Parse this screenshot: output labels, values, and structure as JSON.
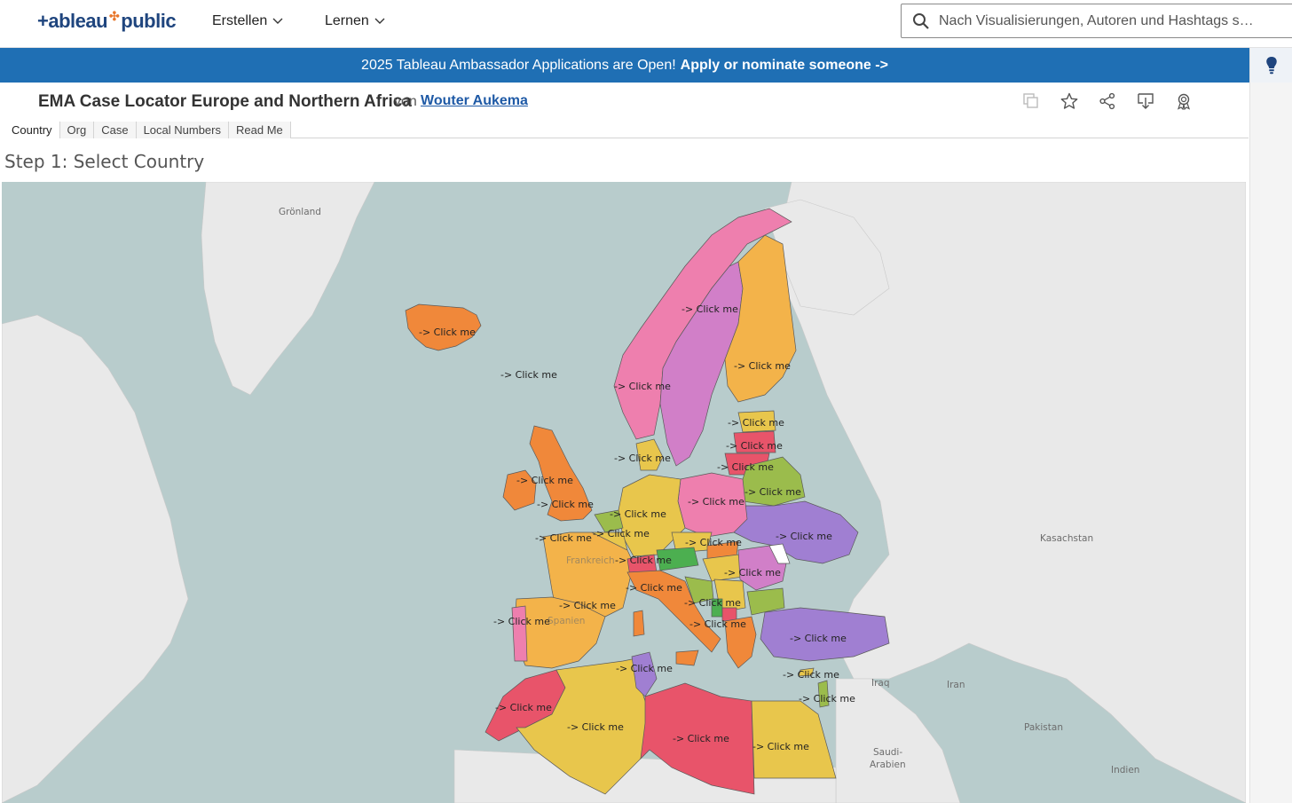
{
  "nav": {
    "logo_left": "+ableau",
    "logo_right": "public",
    "items": [
      {
        "label": "Erstellen"
      },
      {
        "label": "Lernen"
      }
    ],
    "search_placeholder": "Nach Visualisierungen, Autoren und Hashtags s…"
  },
  "banner": {
    "text": "2025 Tableau Ambassador Applications are Open!",
    "cta": "Apply or nominate someone ->"
  },
  "viz": {
    "title": "EMA Case Locator Europe and Northern Africa",
    "by": "von",
    "author": "Wouter Aukema"
  },
  "actions": [
    "copy-icon",
    "star-icon",
    "share-icon",
    "download-icon",
    "badge-icon"
  ],
  "tabs": [
    {
      "label": "Country",
      "active": true
    },
    {
      "label": "Org"
    },
    {
      "label": "Case"
    },
    {
      "label": "Local Numbers"
    },
    {
      "label": "Read Me"
    }
  ],
  "dashboard": {
    "step_title": "Step 1: Select Country",
    "click_label": "-> Click me",
    "geo_labels": {
      "greenland": "Grönland",
      "kazakhstan": "Kasachstan",
      "iraq": "Iraq",
      "iran": "Iran",
      "saudi1": "Saudi-",
      "saudi2": "Arabien",
      "pakistan": "Pakistan",
      "india": "Indien",
      "france": "Frankreich",
      "spain": "Spanien"
    },
    "colors": {
      "ocean": "#b8cccc",
      "land": "#e9e9e9",
      "orange": "#f0883a",
      "yellow": "#e8c64c",
      "pink": "#ee7fae",
      "violet": "#d17fc8",
      "red": "#e8546a",
      "green": "#9bbc4c",
      "purple": "#a07fd2",
      "gold": "#f3b34a"
    }
  }
}
